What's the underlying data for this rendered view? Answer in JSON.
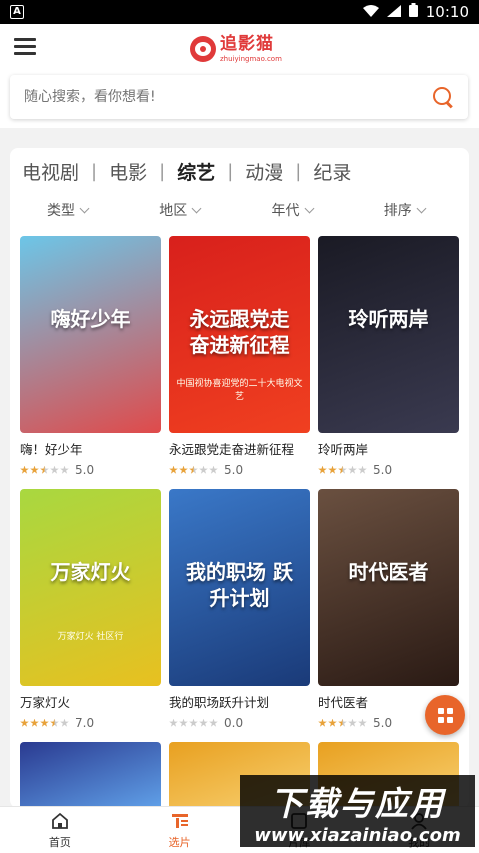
{
  "status_bar": {
    "time": "10:10"
  },
  "header": {
    "logo_cn": "追影猫",
    "logo_en": "zhuiyingmao.com"
  },
  "search": {
    "placeholder": "随心搜索，看你想看!"
  },
  "categories": [
    {
      "label": "电视剧",
      "active": false
    },
    {
      "label": "电影",
      "active": false
    },
    {
      "label": "综艺",
      "active": true
    },
    {
      "label": "动漫",
      "active": false
    },
    {
      "label": "纪录",
      "active": false
    }
  ],
  "filters": [
    "类型",
    "地区",
    "年代",
    "排序"
  ],
  "items": [
    {
      "title": "嗨！好少年",
      "score": "5.0",
      "stars": 2.5,
      "poster_text": "嗨好少年",
      "colors": [
        "#6cc6e8",
        "#e04a4a"
      ]
    },
    {
      "title": "永远跟党走奋进新征程",
      "score": "5.0",
      "stars": 2.5,
      "poster_text": "永远跟党走 奋进新征程",
      "poster_sub": "中国视协喜迎党的二十大电视文艺",
      "colors": [
        "#d8201c",
        "#f04020"
      ]
    },
    {
      "title": "玲听两岸",
      "score": "5.0",
      "stars": 2.5,
      "poster_text": "玲听两岸",
      "colors": [
        "#1a1a24",
        "#3a3a50"
      ]
    },
    {
      "title": "万家灯火",
      "score": "7.0",
      "stars": 3.5,
      "poster_text": "万家灯火",
      "poster_sub": "万家灯火 社区行",
      "colors": [
        "#a8d840",
        "#e8c020"
      ]
    },
    {
      "title": "我的职场跃升计划",
      "score": "0.0",
      "stars": 0,
      "poster_text": "我的职场 跃升计划",
      "colors": [
        "#3a78c8",
        "#1a3a78"
      ]
    },
    {
      "title": "时代医者",
      "score": "5.0",
      "stars": 2.5,
      "poster_text": "时代医者",
      "colors": [
        "#6a5040",
        "#2a1a14"
      ]
    }
  ],
  "bottom_row_posters": [
    {
      "colors": [
        "#2a3a90",
        "#60a0e8"
      ]
    },
    {
      "colors": [
        "#e8a020",
        "#f8d070"
      ]
    },
    {
      "colors": [
        "#e8a020",
        "#f8d070"
      ]
    }
  ],
  "tabbar": [
    {
      "label": "首页",
      "icon": "home-icon",
      "active": false
    },
    {
      "label": "选片",
      "icon": "filter-icon",
      "active": true
    },
    {
      "label": "片库",
      "icon": "library-icon",
      "active": false
    },
    {
      "label": "我的",
      "icon": "user-icon",
      "active": false
    }
  ],
  "watermark": {
    "cn": "下载与应用",
    "en": "www.xiazainiao.com"
  },
  "accent": "#e8652a"
}
